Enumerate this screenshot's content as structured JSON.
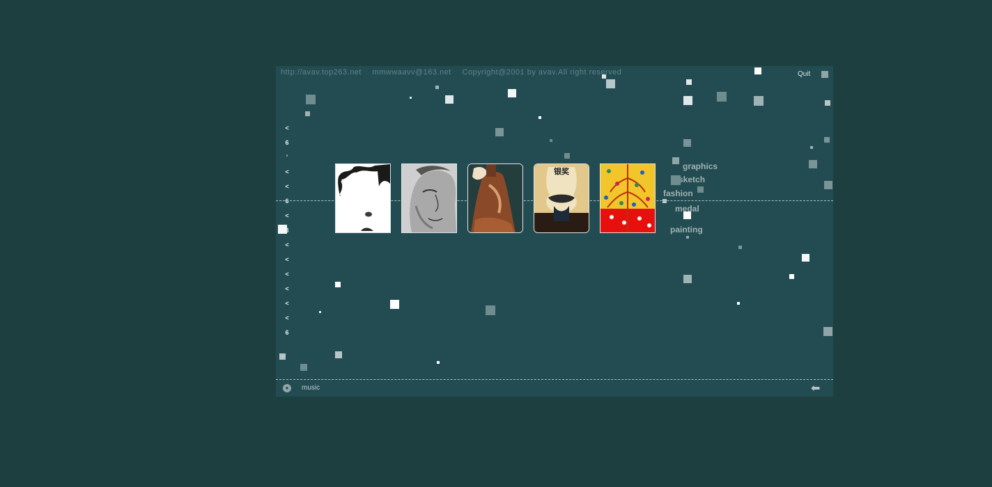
{
  "header": {
    "url": "http://avav.top263.net",
    "email": "mmwwaavv@163.net",
    "copyright": "Copyright@2001 by avav.All right reserved",
    "quit_label": "Quit"
  },
  "side_nav": [
    "<",
    "6",
    "'",
    "<",
    "<",
    "6",
    "<",
    "3",
    "<",
    "<",
    "<",
    "<",
    "<",
    "<",
    "6"
  ],
  "categories": {
    "graphics": "graphics",
    "sketch": "sketch",
    "fashion": "fashion",
    "medal": "medal",
    "painting": "painting"
  },
  "medal_thumb_text": "银奖",
  "footer": {
    "music_label": "music"
  },
  "colors": {
    "page_bg": "#1d3f40",
    "stage_bg": "#234c52",
    "accent_red": "#e8100c",
    "accent_yellow": "#f2c52a"
  }
}
